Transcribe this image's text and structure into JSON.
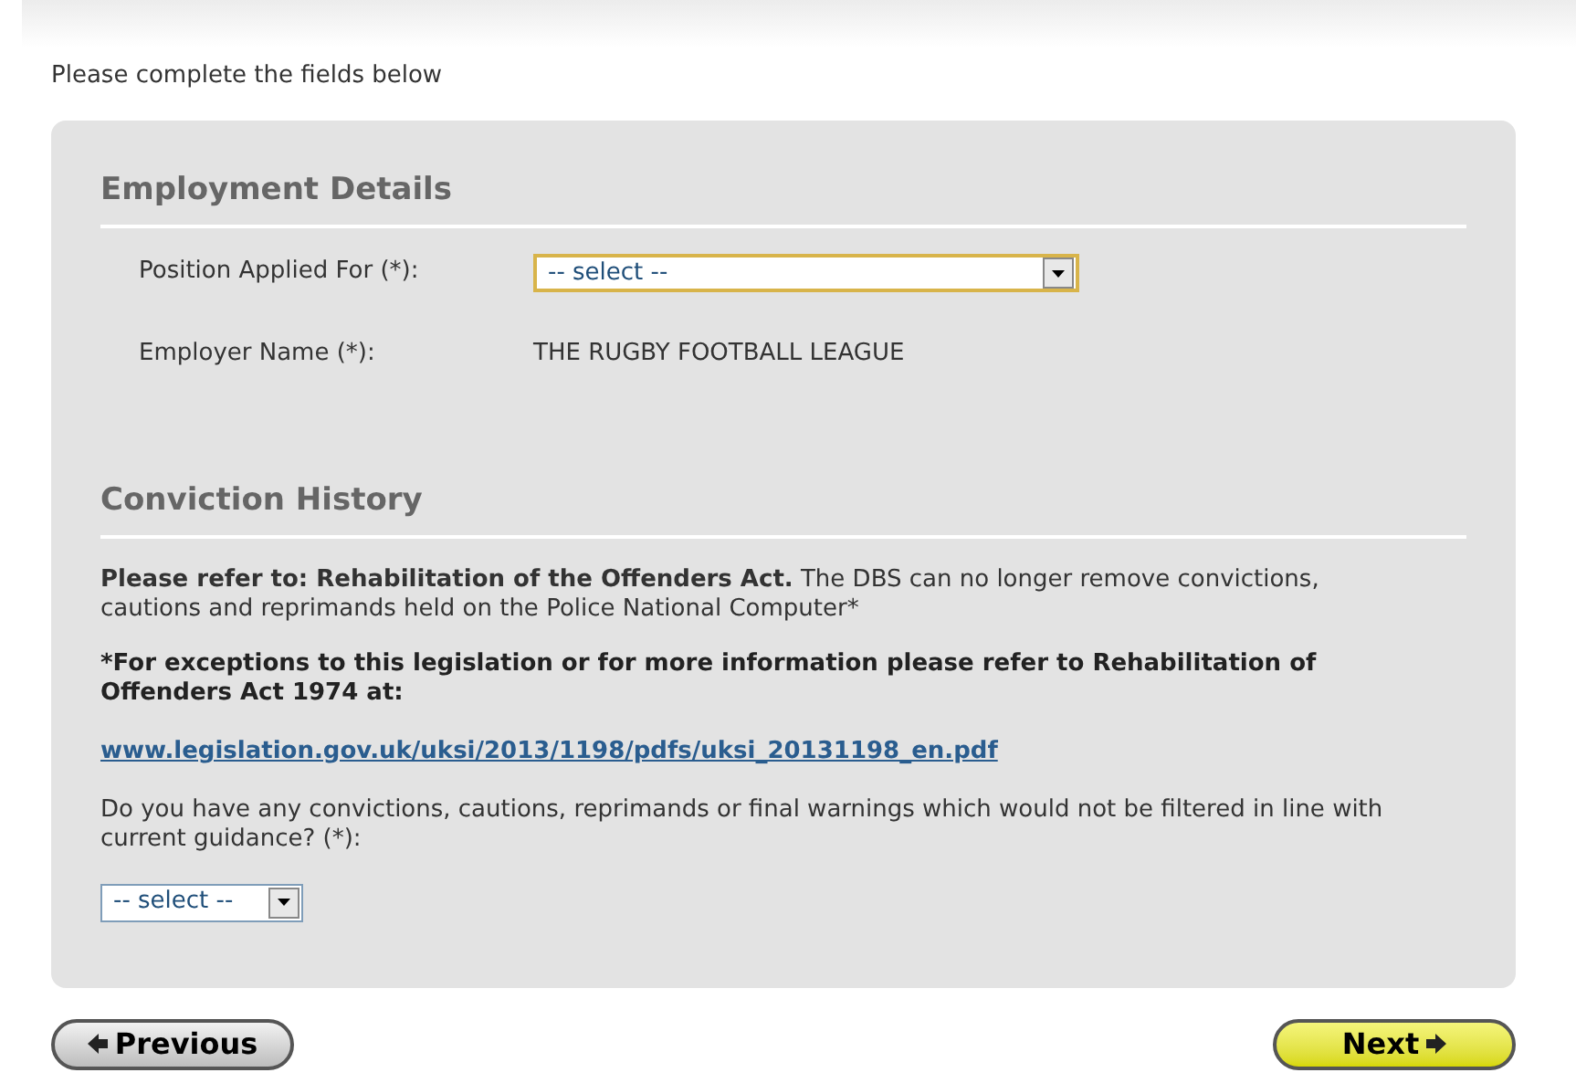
{
  "intro": "Please complete the fields below",
  "sections": [
    {
      "heading": "Employment Details",
      "fields": [
        {
          "kind": "select",
          "label": "Position Applied For (*):",
          "value": "-- select --",
          "focused": true
        },
        {
          "kind": "text",
          "label": "Employer Name (*):",
          "value": "THE RUGBY FOOTBALL LEAGUE"
        }
      ]
    },
    {
      "heading": "Conviction History",
      "paragraphs": [
        {
          "kind": "text",
          "text": "**Please refer to: Rehabilitation of the Offenders Act.** The DBS can no longer remove convictions, cautions and reprimands held on the Police National Computer*"
        },
        {
          "kind": "bold",
          "text": "*For exceptions to this legislation or for more information please refer to Rehabilitation of Offenders Act 1974 at:"
        },
        {
          "kind": "link",
          "text": "www.legislation.gov.uk/uksi/2013/1198/pdfs/uksi_20131198_en.pdf"
        },
        {
          "kind": "text",
          "text": "Do you have any convictions, cautions, reprimands or final warnings which would not be filtered in line with current guidance? (*):"
        }
      ],
      "select": {
        "value": "-- select --",
        "focused": false
      }
    }
  ],
  "buttons": [
    {
      "kind": "previous",
      "label": "Previous"
    },
    {
      "kind": "next",
      "label": "Next"
    }
  ]
}
